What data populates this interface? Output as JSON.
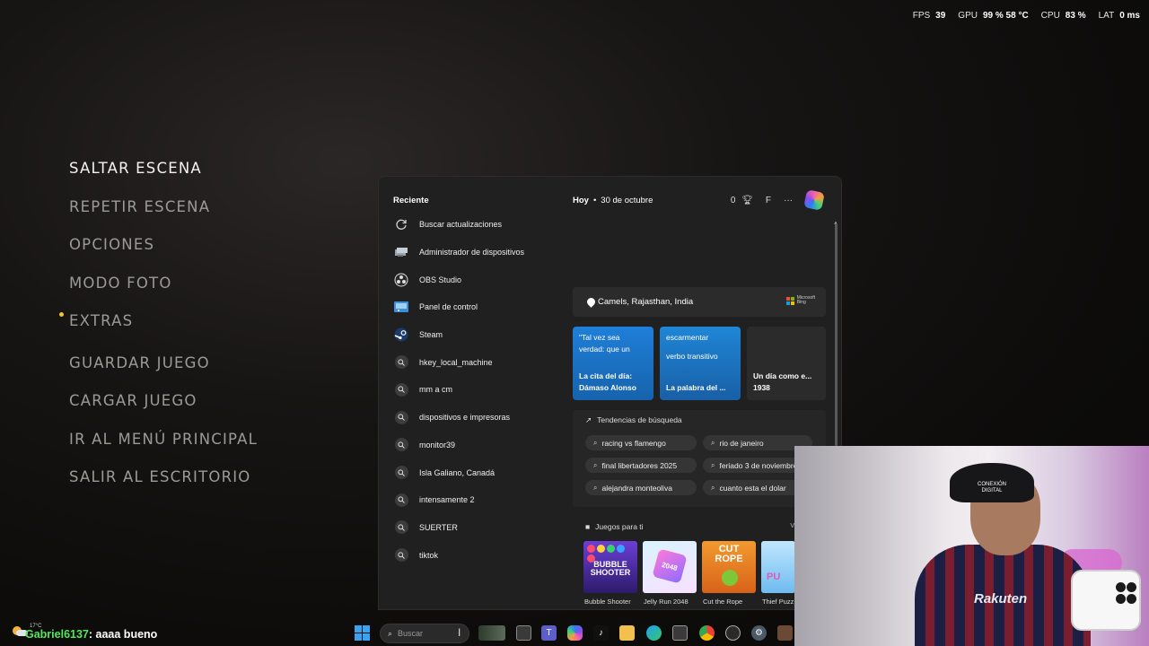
{
  "stats": {
    "fps_label": "FPS",
    "fps": "39",
    "gpu_label": "GPU",
    "gpu": "99 % 58 °C",
    "cpu_label": "CPU",
    "cpu": "83 %",
    "lat_label": "LAT",
    "lat": "0 ms"
  },
  "game_menu": {
    "items": [
      {
        "label": "SALTAR ESCENA"
      },
      {
        "label": "REPETIR ESCENA"
      },
      {
        "label": "OPCIONES"
      },
      {
        "label": "MODO FOTO"
      },
      {
        "label": "EXTRAS"
      },
      {
        "label": "GUARDAR JUEGO"
      },
      {
        "label": "CARGAR JUEGO"
      },
      {
        "label": "IR AL MENÚ PRINCIPAL"
      },
      {
        "label": "SALIR AL ESCRITORIO"
      }
    ],
    "active_index": 0
  },
  "panel": {
    "recent_title": "Reciente",
    "today": "Hoy",
    "date": "30 de octubre",
    "points": "0",
    "profile_initial": "F",
    "more": "···",
    "recent": [
      {
        "label": "Buscar actualizaciones",
        "icon": "refresh-icon"
      },
      {
        "label": "Administrador de dispositivos",
        "icon": "device-manager-icon"
      },
      {
        "label": "OBS Studio",
        "icon": "obs-icon"
      },
      {
        "label": "Panel de control",
        "icon": "control-panel-icon"
      },
      {
        "label": "Steam",
        "icon": "steam-icon"
      },
      {
        "label": "hkey_local_machine",
        "icon": "search-icon"
      },
      {
        "label": "mm a cm",
        "icon": "search-icon"
      },
      {
        "label": "dispositivos e impresoras",
        "icon": "search-icon"
      },
      {
        "label": "monitor39",
        "icon": "search-icon"
      },
      {
        "label": "Isla Galiano, Canadá",
        "icon": "search-icon"
      },
      {
        "label": "intensamente 2",
        "icon": "search-icon"
      },
      {
        "label": "SUERTER",
        "icon": "search-icon"
      },
      {
        "label": "tiktok",
        "icon": "search-icon"
      }
    ],
    "location": "Camels, Rajasthan, India",
    "bing": {
      "line1": "Microsoft",
      "line2": "Bing"
    },
    "cards": [
      {
        "top": "\"Tal vez sea verdad: que un",
        "bottom": "La cita del día: Dámaso Alonso"
      },
      {
        "top": "escarmentar",
        "top2": "verbo transitivo",
        "bottom": "La palabra del ..."
      },
      {
        "top": "",
        "bottom": "Un día como e... 1938"
      }
    ],
    "trends_title": "Tendencias de búsqueda",
    "trends": [
      "racing vs flamengo",
      "rio de janeiro",
      "final libertadores 2025",
      "feriado 3 de noviembre",
      "alejandra monteoliva",
      "cuanto esta el dolar"
    ],
    "games_title": "Juegos para ti",
    "games_more": "V",
    "games": [
      {
        "title": "Bubble Shooter",
        "art": "BUBBLE SHOOTER"
      },
      {
        "title": "Jelly Run 2048",
        "art": "2048"
      },
      {
        "title": "Cut the Rope",
        "art": "CUT ROPE"
      },
      {
        "title": "Thief Puzz",
        "art": "PU"
      }
    ]
  },
  "webcam": {
    "cap_text": "CONEXIÓN DIGITAL",
    "shirt_text": "Rakuten"
  },
  "chat": {
    "temp": "17°C",
    "user": "Gabriel6137",
    "message": ": aaaa bueno"
  },
  "taskbar": {
    "search_placeholder": "Buscar",
    "apps": [
      "search-highlight-icon",
      "task-view-icon",
      "teams-icon",
      "copilot-icon",
      "tiktok-icon",
      "file-explorer-icon",
      "edge-icon",
      "store-icon",
      "chrome-icon",
      "recording-app-icon",
      "settings-icon",
      "game-icon"
    ]
  }
}
